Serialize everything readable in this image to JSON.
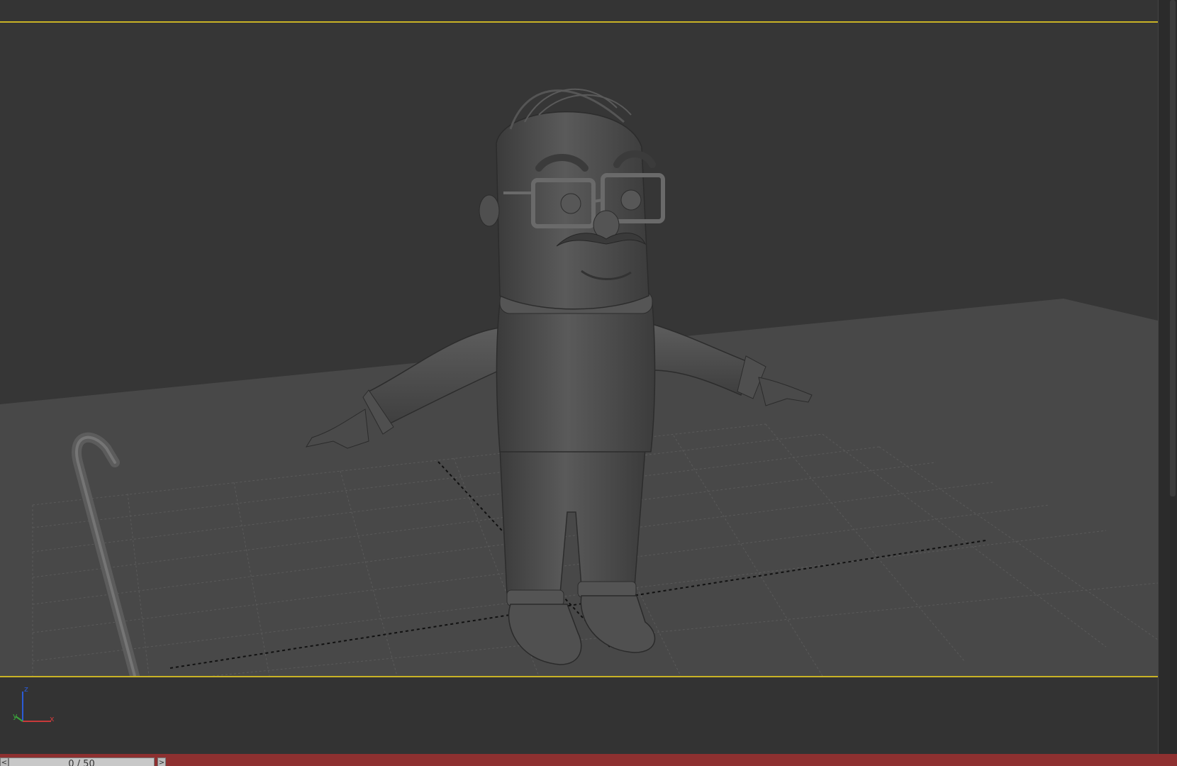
{
  "viewport": {
    "active_border_color": "#c9b326",
    "background_color": "#363636",
    "floor_color": "#484848"
  },
  "timeline": {
    "frame_display": "0 / 50",
    "prev_arrow": "<",
    "next_arrow": ">"
  },
  "axis_gizmo": {
    "z_label": "z",
    "y_label": "y",
    "x_label": "x"
  },
  "status_bar": {
    "color": "#8e3030"
  }
}
